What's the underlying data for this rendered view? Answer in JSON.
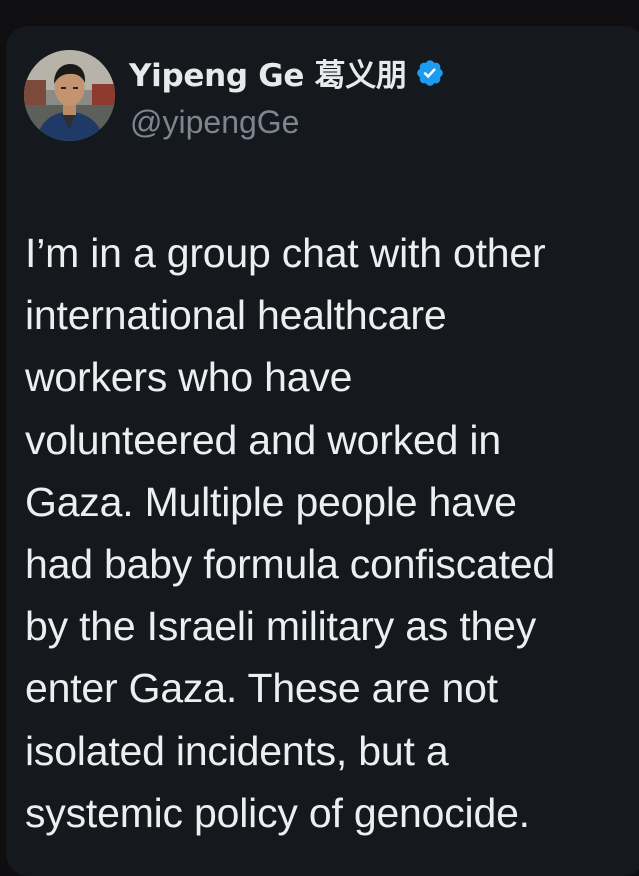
{
  "tweet": {
    "author": {
      "display_name": "Yipeng Ge 葛义朋",
      "handle": "@yipengGe",
      "verified": true,
      "avatar_icon": "profile-photo",
      "verified_icon": "verified-badge-icon",
      "verified_color": "#1d9bf0"
    },
    "text": "I’m in a group chat with other\ninternational healthcare\nworkers who have\nvolunteered and worked in\nGaza. Multiple people have\nhad baby formula confiscated\nby the Israeli military as they\nenter Gaza. These are not\nisolated incidents, but a\nsystemic policy of genocide."
  },
  "colors": {
    "card_background": "#15181d",
    "text": "#eceef0",
    "secondary_text": "#7d8590"
  }
}
